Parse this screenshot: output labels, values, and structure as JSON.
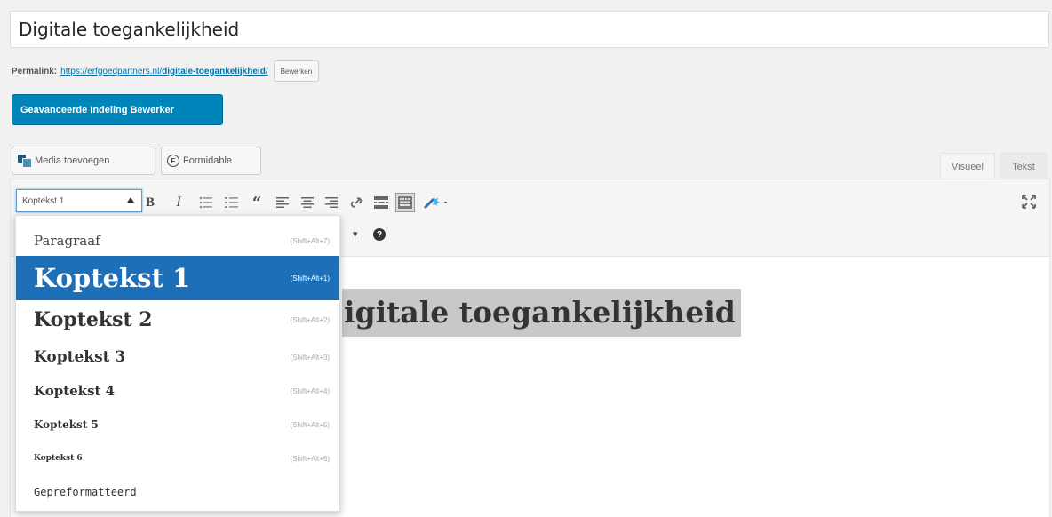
{
  "post": {
    "title": "Digitale toegankelijkheid"
  },
  "permalink": {
    "label": "Permalink:",
    "url_prefix": "https://erfgoedpartners.nl/",
    "slug": "digitale-toegankelijkheid",
    "url_suffix": "/",
    "edit_label": "Bewerken"
  },
  "buttons": {
    "advanced_layout": "Geavanceerde Indeling Bewerker",
    "add_media": "Media toevoegen",
    "formidable": "Formidable"
  },
  "editor_tabs": {
    "visual": "Visueel",
    "text": "Tekst"
  },
  "format_select": {
    "value": "Koptekst 1"
  },
  "content": {
    "heading_visible": "igitale toegankelijkheid"
  },
  "format_dropdown": {
    "items": [
      {
        "label": "Paragraaf",
        "shortcut": "(Shift+Alt+7)"
      },
      {
        "label": "Koptekst 1",
        "shortcut": "(Shift+Alt+1)"
      },
      {
        "label": "Koptekst 2",
        "shortcut": "(Shift+Alt+2)"
      },
      {
        "label": "Koptekst 3",
        "shortcut": "(Shift+Alt+3)"
      },
      {
        "label": "Koptekst 4",
        "shortcut": "(Shift+Alt+4)"
      },
      {
        "label": "Koptekst 5",
        "shortcut": "(Shift+Alt+5)"
      },
      {
        "label": "Koptekst 6",
        "shortcut": "(Shift+Alt+6)"
      },
      {
        "label": "Gepreformatteerd",
        "shortcut": ""
      }
    ]
  },
  "help": {
    "symbol": "?"
  },
  "colors": {
    "primary_button": "#0085ba",
    "selected_item": "#1d6fb8",
    "link": "#0073aa"
  }
}
